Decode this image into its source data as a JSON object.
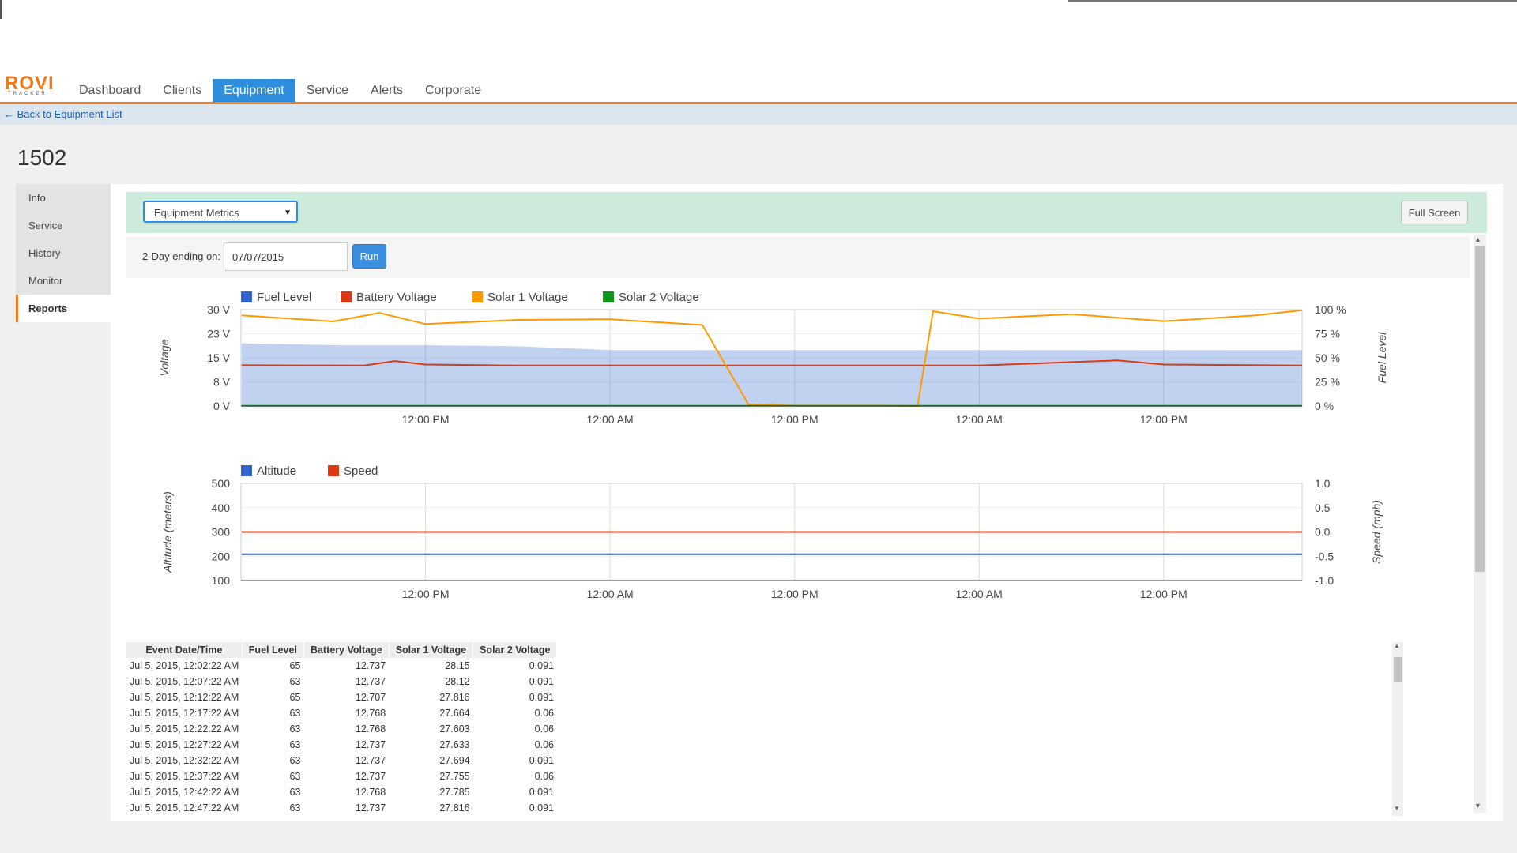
{
  "app": {
    "logo_text": "ROVI",
    "logo_sub": "TRACKER"
  },
  "nav": {
    "items": [
      {
        "label": "Dashboard",
        "active": false
      },
      {
        "label": "Clients",
        "active": false
      },
      {
        "label": "Equipment",
        "active": true
      },
      {
        "label": "Service",
        "active": false
      },
      {
        "label": "Alerts",
        "active": false
      },
      {
        "label": "Corporate",
        "active": false
      }
    ]
  },
  "breadcrumb": {
    "back_label": "← Back to Equipment List"
  },
  "page": {
    "title": "1502"
  },
  "sidebar": {
    "items": [
      {
        "label": "Info",
        "active": false
      },
      {
        "label": "Service",
        "active": false
      },
      {
        "label": "History",
        "active": false
      },
      {
        "label": "Monitor",
        "active": false
      },
      {
        "label": "Reports",
        "active": true
      }
    ]
  },
  "toolbar": {
    "report_select": "Equipment Metrics",
    "full_screen_label": "Full Screen",
    "filter_label": "2-Day ending on:",
    "date_value": "07/07/2015",
    "run_label": "Run"
  },
  "colors": {
    "accent": "#ee7a1c",
    "active_tab": "#2f8fde",
    "fuel": "#3366cc",
    "battery": "#dc3912",
    "solar1": "#ff9900",
    "solar2": "#109618",
    "green_bar": "#cdebdb"
  },
  "chart_data": [
    {
      "type": "line",
      "legend_position": "top-left",
      "series": [
        {
          "name": "Fuel Level",
          "color": "#3366cc",
          "axis": "right",
          "style": "area",
          "x": [
            "Jul 5, 2015, 12:02:22 AM",
            "Jul 5, 2015, 06:30 AM",
            "Jul 5, 2015, 12:00 PM",
            "Jul 5, 2015, 06:00 PM",
            "Jul 6, 2015, 12:00 AM",
            "Jul 6, 2015, 06:00 AM",
            "Jul 6, 2015, 12:00 PM",
            "Jul 6, 2015, 06:00 PM",
            "Jul 7, 2015, 12:00 AM",
            "Jul 7, 2015, 06:00 AM",
            "Jul 7, 2015, 12:00 PM",
            "Jul 7, 2015, 06:00 PM",
            "Jul 7, 2015, 09:00 PM"
          ],
          "y": [
            65,
            63,
            63,
            62,
            58,
            58,
            58,
            58,
            58,
            58,
            58,
            58,
            58
          ]
        },
        {
          "name": "Battery Voltage",
          "color": "#dc3912",
          "axis": "left",
          "x": [
            "Jul 5, 2015, 12:02:22 AM",
            "Jul 5, 2015, 08:00 AM",
            "Jul 5, 2015, 10:00 AM",
            "Jul 5, 2015, 12:00 PM",
            "Jul 5, 2015, 06:00 PM",
            "Jul 6, 2015, 12:00 AM",
            "Jul 6, 2015, 12:00 PM",
            "Jul 7, 2015, 12:00 AM",
            "Jul 7, 2015, 09:00 AM",
            "Jul 7, 2015, 12:00 PM",
            "Jul 7, 2015, 09:00 PM"
          ],
          "y": [
            12.7,
            12.6,
            14.0,
            12.9,
            12.6,
            12.6,
            12.6,
            12.6,
            14.2,
            12.9,
            12.6
          ]
        },
        {
          "name": "Solar 1 Voltage",
          "color": "#ff9900",
          "axis": "left",
          "x": [
            "Jul 5, 2015, 12:02:22 AM",
            "Jul 5, 2015, 06:00 AM",
            "Jul 5, 2015, 09:00 AM",
            "Jul 5, 2015, 12:00 PM",
            "Jul 5, 2015, 06:00 PM",
            "Jul 6, 2015, 12:00 AM",
            "Jul 6, 2015, 06:00 AM",
            "Jul 6, 2015, 09:00 AM",
            "Jul 6, 2015, 12:00 PM",
            "Jul 6, 2015, 06:00 PM",
            "Jul 6, 2015, 08:00 PM",
            "Jul 6, 2015, 09:00 PM",
            "Jul 7, 2015, 12:00 AM",
            "Jul 7, 2015, 06:00 AM",
            "Jul 7, 2015, 12:00 PM",
            "Jul 7, 2015, 06:00 PM",
            "Jul 7, 2015, 09:00 PM"
          ],
          "y": [
            28.2,
            26.3,
            29.0,
            25.5,
            26.8,
            27.0,
            25.2,
            0.5,
            0.1,
            0.1,
            0.0,
            29.5,
            27.2,
            28.6,
            26.4,
            28.2,
            29.8
          ]
        },
        {
          "name": "Solar 2 Voltage",
          "color": "#109618",
          "axis": "left",
          "x": [
            "Jul 5, 2015, 12:02:22 AM",
            "Jul 7, 2015, 09:00 PM"
          ],
          "y": [
            0.06,
            0.06
          ]
        }
      ],
      "y_left": {
        "label": "Voltage",
        "ticks": [
          "30 V",
          "23 V",
          "15 V",
          "8 V",
          "0 V"
        ],
        "range": [
          0,
          30
        ]
      },
      "y_right": {
        "label": "Fuel Level",
        "ticks": [
          "100 %",
          "75 %",
          "50 %",
          "25 %",
          "0 %"
        ],
        "range": [
          0,
          100
        ]
      },
      "x_ticks": [
        "12:00 PM",
        "12:00 AM",
        "12:00 PM",
        "12:00 AM",
        "12:00 PM"
      ],
      "grid": true
    },
    {
      "type": "line",
      "legend_position": "top-left",
      "series": [
        {
          "name": "Altitude",
          "color": "#3366cc",
          "axis": "left",
          "x": [
            "Jul 5, 2015, 12:02:22 AM",
            "Jul 7, 2015, 09:00 PM"
          ],
          "y": [
            208,
            208
          ]
        },
        {
          "name": "Speed",
          "color": "#dc3912",
          "axis": "right",
          "x": [
            "Jul 5, 2015, 12:02:22 AM",
            "Jul 7, 2015, 09:00 PM"
          ],
          "y": [
            0.0,
            0.0
          ]
        }
      ],
      "y_left": {
        "label": "Altitude (meters)",
        "ticks": [
          "500",
          "400",
          "300",
          "200",
          "100"
        ],
        "range": [
          100,
          500
        ]
      },
      "y_right": {
        "label": "Speed (mph)",
        "ticks": [
          "1.0",
          "0.5",
          "0.0",
          "-0.5",
          "-1.0"
        ],
        "range": [
          -1,
          1
        ]
      },
      "x_ticks": [
        "12:00 PM",
        "12:00 AM",
        "12:00 PM",
        "12:00 AM",
        "12:00 PM"
      ],
      "grid": true
    },
    {
      "type": "table",
      "columns": [
        "Event Date/Time",
        "Fuel Level",
        "Battery Voltage",
        "Solar 1 Voltage",
        "Solar 2 Voltage"
      ],
      "rows": [
        [
          "Jul 5, 2015, 12:02:22 AM",
          "65",
          "12.737",
          "28.15",
          "0.091"
        ],
        [
          "Jul 5, 2015, 12:07:22 AM",
          "63",
          "12.737",
          "28.12",
          "0.091"
        ],
        [
          "Jul 5, 2015, 12:12:22 AM",
          "65",
          "12.707",
          "27.816",
          "0.091"
        ],
        [
          "Jul 5, 2015, 12:17:22 AM",
          "63",
          "12.768",
          "27.664",
          "0.06"
        ],
        [
          "Jul 5, 2015, 12:22:22 AM",
          "63",
          "12.768",
          "27.603",
          "0.06"
        ],
        [
          "Jul 5, 2015, 12:27:22 AM",
          "63",
          "12.737",
          "27.633",
          "0.06"
        ],
        [
          "Jul 5, 2015, 12:32:22 AM",
          "63",
          "12.737",
          "27.694",
          "0.091"
        ],
        [
          "Jul 5, 2015, 12:37:22 AM",
          "63",
          "12.737",
          "27.755",
          "0.06"
        ],
        [
          "Jul 5, 2015, 12:42:22 AM",
          "63",
          "12.768",
          "27.785",
          "0.091"
        ],
        [
          "Jul 5, 2015, 12:47:22 AM",
          "63",
          "12.737",
          "27.816",
          "0.091"
        ]
      ]
    }
  ]
}
